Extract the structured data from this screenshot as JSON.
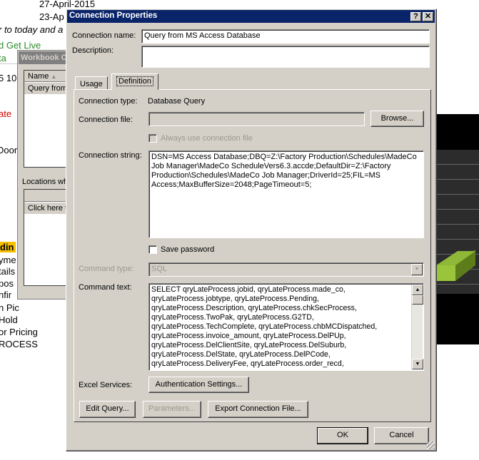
{
  "background": {
    "sheet_lines": [
      {
        "text": "27-April-2015"
      },
      {
        "text": "23-Ap"
      },
      {
        "text": "r to today and a"
      },
      {
        "text": "d Get Live"
      },
      {
        "text": "ta"
      },
      {
        "text": "5 10"
      },
      {
        "text": "ate"
      },
      {
        "text": "Door"
      },
      {
        "text": "din"
      },
      {
        "text": "yme"
      },
      {
        "text": "tails"
      },
      {
        "text": "pos"
      },
      {
        "text": "nfir"
      },
      {
        "text": "n Pic"
      },
      {
        "text": "Hold"
      },
      {
        "text": "or Pricing"
      },
      {
        "text": "ROCESS"
      }
    ],
    "workbook_window": {
      "title": "Workbook C",
      "name_header": "Name",
      "name_row": "Query from",
      "locations_label": "Locations wh",
      "locations_row": "Click here t"
    }
  },
  "dialog": {
    "title": "Connection Properties",
    "help": "?",
    "close": "✕",
    "connection_name_label": "Connection name:",
    "connection_name_value": "Query from MS Access Database",
    "description_label": "Description:",
    "description_value": "",
    "tabs": [
      {
        "label": "Usage"
      },
      {
        "label": "Definition",
        "active": true
      }
    ],
    "definition": {
      "connection_type_label": "Connection type:",
      "connection_type_value": "Database Query",
      "connection_file_label": "Connection file:",
      "connection_file_value": "",
      "browse_label": "Browse...",
      "always_use_label": "Always use connection file",
      "connection_string_label": "Connection string:",
      "connection_string_value": "DSN=MS Access Database;DBQ=Z:\\Factory Production\\Schedules\\MadeCo Job Manager\\MadeCo ScheduleVers6.3.accde;DefaultDir=Z:\\Factory Production\\Schedules\\MadeCo Job Manager;DriverId=25;FIL=MS Access;MaxBufferSize=2048;PageTimeout=5;",
      "save_password_label": "Save password",
      "command_type_label": "Command type:",
      "command_type_value": "SQL",
      "command_text_label": "Command text:",
      "command_text_value": "SELECT qryLateProcess.jobid, qryLateProcess.made_co,\nqryLateProcess.jobtype, qryLateProcess.Pending,\nqryLateProcess.Description, qryLateProcess.chkSecProcess,\nqryLateProcess.TwoPak, qryLateProcess.G2TD,\nqryLateProcess.TechComplete, qryLateProcess.chbMCDispatched,\nqryLateProcess.invoice_amount, qryLateProcess.DelPUp,\nqryLateProcess.DelClientSite, qryLateProcess.DelSuburb,\nqryLateProcess.DelState, qryLateProcess.DelPCode,\nqryLateProcess.DeliveryFee, qryLateProcess.order_recd,",
      "excel_services_label": "Excel Services:",
      "auth_settings_label": "Authentication Settings...",
      "edit_query_label": "Edit Query...",
      "parameters_label": "Parameters...",
      "export_label": "Export Connection File..."
    },
    "ok_label": "OK",
    "cancel_label": "Cancel"
  }
}
